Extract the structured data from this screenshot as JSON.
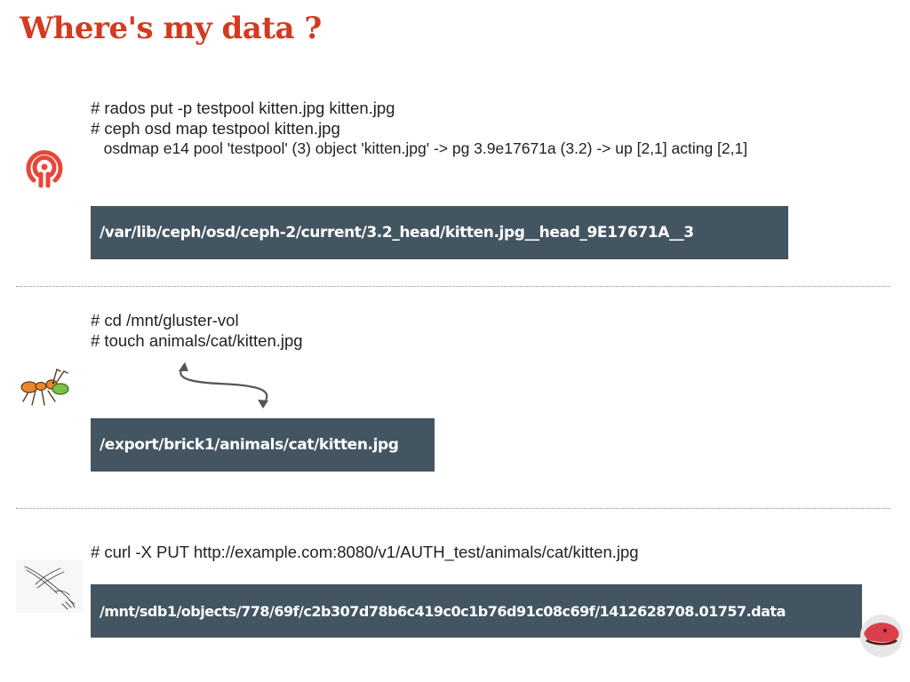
{
  "title": "Where's my data ?",
  "ceph": {
    "lines": [
      "# rados put -p testpool kitten.jpg kitten.jpg",
      "# ceph osd map testpool kitten.jpg",
      "   osdmap e14 pool 'testpool' (3) object 'kitten.jpg' -> pg 3.9e17671a (3.2) -> up [2,1] acting [2,1]"
    ],
    "path": "/var/lib/ceph/osd/ceph-2/current/3.2_head/kitten.jpg__head_9E17671A__3",
    "icon": "ceph-logo-icon"
  },
  "gluster": {
    "lines": [
      "# cd /mnt/gluster-vol",
      "# touch animals/cat/kitten.jpg"
    ],
    "path": "/export/brick1/animals/cat/kitten.jpg",
    "icon": "gluster-ant-icon"
  },
  "swift": {
    "lines": [
      "# curl -X PUT http://example.com:8080/v1/AUTH_test/animals/cat/kitten.jpg"
    ],
    "path": "/mnt/sdb1/objects/778/69f/c2b307d78b6c419c0c1b76d91c08c69f/1412628708.01757.data",
    "icon": "swift-bird-icon"
  },
  "colors": {
    "title": "#d33a1f",
    "path_box": "#445562",
    "ceph_logo": "#e6473b"
  }
}
